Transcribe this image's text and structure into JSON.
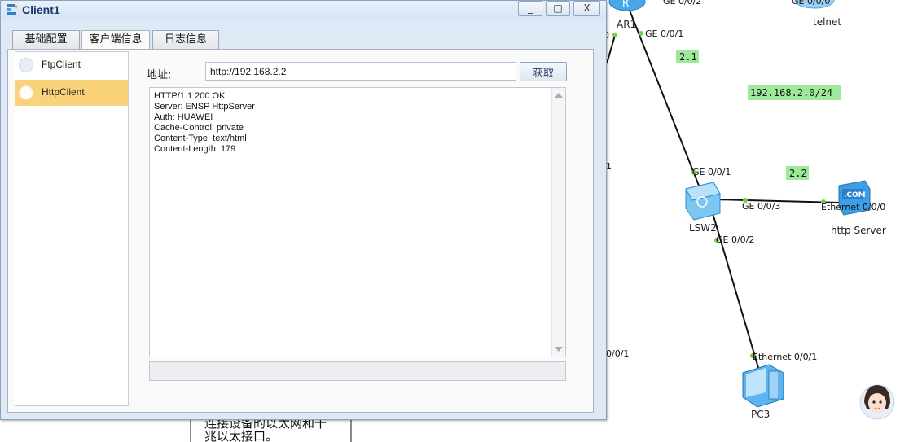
{
  "window": {
    "title": "Client1",
    "controls": {
      "minimize": "_",
      "maximize": "□",
      "close": "X"
    }
  },
  "tabs": [
    {
      "label": "基础配置"
    },
    {
      "label": "客户端信息"
    },
    {
      "label": "日志信息"
    }
  ],
  "client_list": [
    {
      "label": "FtpClient",
      "selected": false
    },
    {
      "label": "HttpClient",
      "selected": true
    }
  ],
  "address": {
    "label": "地址:",
    "value": "http://192.168.2.2",
    "fetch_label": "获取"
  },
  "response_lines": [
    "HTTP/1.1 200 OK",
    "Server: ENSP HttpServer",
    "Auth: HUAWEI",
    "Cache-Control: private",
    "Content-Type: text/html",
    "Content-Length: 179"
  ],
  "tooltip": {
    "line1": "连接设备的以太网和千",
    "line2": "兆以太接口。"
  },
  "topology": {
    "devices": {
      "ar1": "AR1",
      "telnet": "telnet",
      "lsw2": "LSW2",
      "http_server": "http Server",
      "pc3": "PC3"
    },
    "ports": {
      "ar1_ge002": "GE 0/0/2",
      "telnet_port": "GE 0/0/0",
      "ar1_ge001": "GE 0/0/1",
      "ar1_left": "0",
      "left_mid": "1",
      "left_low": "0/0/1",
      "lsw2_ge001": "GE 0/0/1",
      "lsw2_ge003": "GE 0/0/3",
      "lsw2_ge002": "GE 0/0/2",
      "server_eth": "Ethernet 0/0/0",
      "pc3_eth": "Ethernet 0/0/1",
      "server_icon_text": ".COM"
    },
    "notes": {
      "n21": "2.1",
      "net": "192.168.2.0/24",
      "n22": "2.2"
    }
  },
  "colors": {
    "note_bg": "#9ee89a",
    "port_dot": "#6fd04a",
    "selected_item": "#f9d27a",
    "device_blue": "#4aa8e8"
  }
}
